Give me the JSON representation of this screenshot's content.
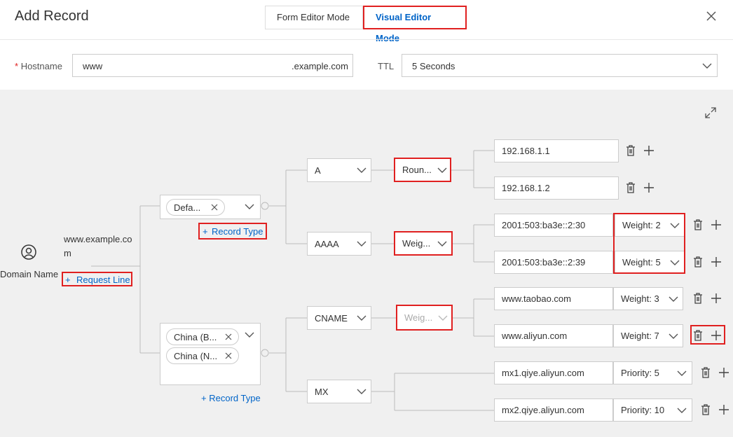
{
  "header": {
    "title": "Add Record",
    "tabs": [
      {
        "label": "Form Editor Mode",
        "active": false
      },
      {
        "label": "Visual Editor Mode",
        "active": true
      }
    ]
  },
  "form": {
    "hostname_required_mark": "*",
    "hostname_label": "Hostname",
    "hostname_value": "www",
    "hostname_suffix": ".example.com",
    "ttl_label": "TTL",
    "ttl_value": "5 Seconds"
  },
  "tree": {
    "root_label": "Domain Name",
    "domain_line1": "www.example.co",
    "domain_line2": "m",
    "request_line": "Request Line",
    "line_groups": [
      {
        "tags": [
          "Defa..."
        ],
        "add_record_type": "Record Type",
        "record_types": [
          {
            "type": "A",
            "policy": "Roun...",
            "values": [
              {
                "value": "192.168.1.1"
              },
              {
                "value": "192.168.1.2"
              }
            ]
          },
          {
            "type": "AAAA",
            "policy": "Weig...",
            "values": [
              {
                "value": "2001:503:ba3e::2:30",
                "weight": "Weight: 2"
              },
              {
                "value": "2001:503:ba3e::2:39",
                "weight": "Weight: 5"
              }
            ]
          }
        ]
      },
      {
        "tags": [
          "China (B...",
          "China (N..."
        ],
        "add_record_type": "Record Type",
        "record_types": [
          {
            "type": "CNAME",
            "policy": "Weig...",
            "values": [
              {
                "value": "www.taobao.com",
                "weight": "Weight: 3"
              },
              {
                "value": "www.aliyun.com",
                "weight": "Weight: 7"
              }
            ]
          },
          {
            "type": "MX",
            "policy": "",
            "values": [
              {
                "value": "mx1.qiye.aliyun.com",
                "weight": "Priority: 5"
              },
              {
                "value": "mx2.qiye.aliyun.com",
                "weight": "Priority: 10"
              }
            ]
          }
        ]
      }
    ]
  },
  "colors": {
    "accent": "#0064c8",
    "highlight": "#e02020",
    "canvas": "#f0f0f0"
  },
  "icons": [
    "user-circle-icon",
    "close-icon",
    "expand-icon",
    "chevron-down-icon",
    "trash-icon",
    "plus-icon",
    "tag-close-icon"
  ]
}
